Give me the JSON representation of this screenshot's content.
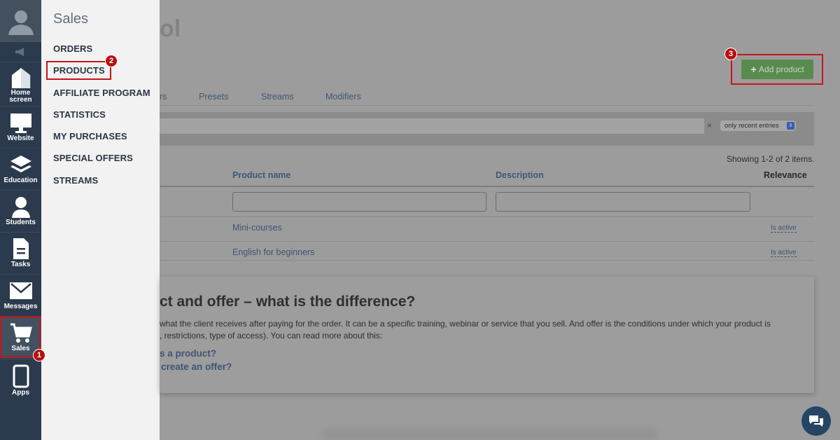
{
  "sidebar": {
    "items": [
      {
        "label": "Home\nscreen"
      },
      {
        "label": "Website"
      },
      {
        "label": "Education"
      },
      {
        "label": "Students"
      },
      {
        "label": "Tasks"
      },
      {
        "label": "Messages"
      },
      {
        "label": "Sales"
      },
      {
        "label": "Apps"
      }
    ]
  },
  "menu": {
    "title": "Sales",
    "items": [
      "ORDERS",
      "PRODUCTS",
      "AFFILIATE PROGRAM",
      "STATISTICS",
      "MY PURCHASES",
      "SPECIAL OFFERS",
      "STREAMS"
    ]
  },
  "main": {
    "title_fragment": "ol",
    "add_button": "Add product",
    "tabs": [
      "rs",
      "Presets",
      "Streams",
      "Modifiers"
    ],
    "filter": {
      "clear": "×",
      "select_value": "only recent entries"
    },
    "showing": "Showing 1-2 of 2 items.",
    "table": {
      "headers": [
        "Product name",
        "Description",
        "Relevance"
      ],
      "rows": [
        {
          "name": "Mini-courses",
          "relevance": "Is active"
        },
        {
          "name": "English for beginners",
          "relevance": "Is active"
        }
      ]
    },
    "info": {
      "title": "ct and offer – what is the difference?",
      "line1": "what the client receives after paying for the order. It can be a specific training, webinar or service that you sell. And offer is the conditions under which your product is",
      "line2": ", restrictions, type of access). You can read more about this:",
      "link1": "s a product?",
      "link2": "create an offer?"
    }
  },
  "markers": [
    "1",
    "2",
    "3"
  ],
  "colors": {
    "accent": "#c4161c",
    "sidebar": "#2b3a4c",
    "button": "#5a8b4e"
  }
}
